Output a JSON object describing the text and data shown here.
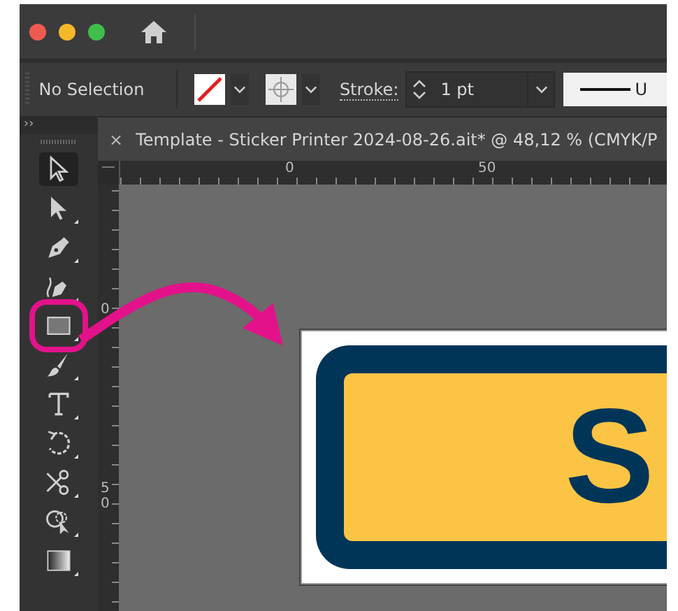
{
  "control_bar": {
    "selection": "No Selection",
    "stroke_label": "Stroke:",
    "stroke_weight": "1 pt",
    "profile_label": "U"
  },
  "document_tab": {
    "close": "×",
    "title": "Template - Sticker Printer 2024-08-26.ait* @ 48,12 % (CMYK/P"
  },
  "rulers": {
    "horizontal": [
      "0",
      "50"
    ],
    "vertical": [
      "0",
      "50"
    ]
  },
  "tools_panel": {
    "collapse": "››"
  },
  "tools": [
    {
      "kind": "selection",
      "selected": true
    },
    {
      "kind": "direct-selection",
      "selected": false
    },
    {
      "kind": "pen",
      "selected": false
    },
    {
      "kind": "curvature",
      "selected": false
    },
    {
      "kind": "rectangle",
      "selected": false
    },
    {
      "kind": "paintbrush",
      "selected": false
    },
    {
      "kind": "type",
      "selected": false
    },
    {
      "kind": "rotate",
      "selected": false
    },
    {
      "kind": "scissors",
      "selected": false
    },
    {
      "kind": "shape-builder",
      "selected": false
    },
    {
      "kind": "gradient",
      "selected": false
    }
  ],
  "artwork": {
    "text": "S"
  }
}
